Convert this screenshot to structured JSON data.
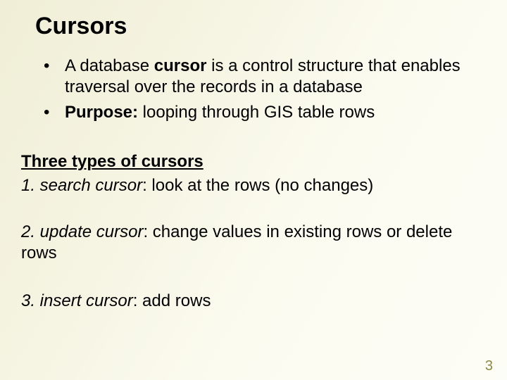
{
  "title": "Cursors",
  "bullets": {
    "b1_pre": "A database ",
    "b1_bold": "cursor",
    "b1_post": " is a control structure that enables traversal over the records in a database",
    "b2_bold": "Purpose:",
    "b2_post": " looping through GIS table rows"
  },
  "section_heading": "Three types of cursors",
  "items": {
    "n1_ital": "1.  search cursor",
    "n1_rest": ":  look at the rows (no changes)",
    "n2_ital": "2. update cursor",
    "n2_rest": ": change values in existing rows or delete rows",
    "n3_ital": "3. insert cursor",
    "n3_rest": ":  add rows"
  },
  "page_number": "3"
}
